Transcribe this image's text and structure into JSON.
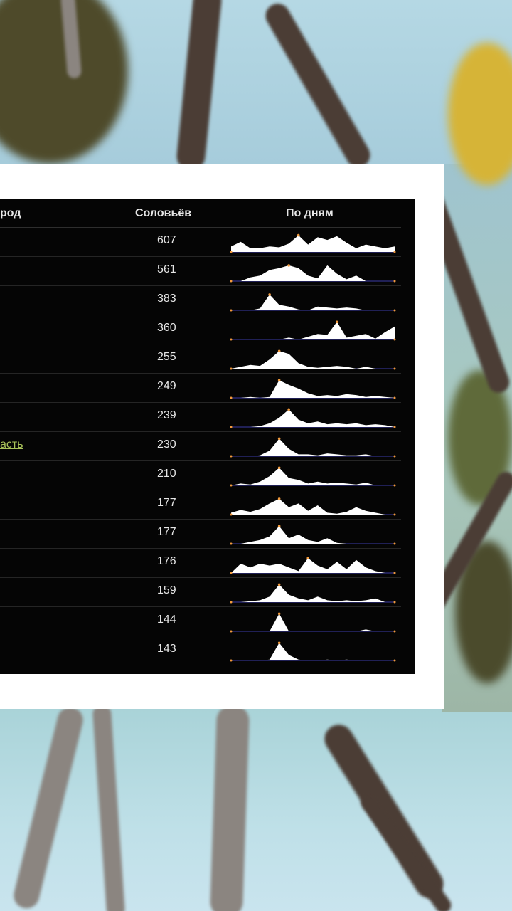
{
  "table": {
    "headers": {
      "city": "род",
      "count": "Соловьёв",
      "days": "По дням"
    },
    "rows": [
      {
        "city": "",
        "count": "607",
        "spark": [
          0.3,
          0.55,
          0.2,
          0.2,
          0.3,
          0.25,
          0.45,
          0.9,
          0.4,
          0.8,
          0.65,
          0.85,
          0.5,
          0.2,
          0.4,
          0.3,
          0.2,
          0.3
        ]
      },
      {
        "city": "",
        "count": "561",
        "spark": [
          0,
          0,
          0.2,
          0.3,
          0.6,
          0.7,
          0.85,
          0.7,
          0.3,
          0.15,
          0.85,
          0.4,
          0.1,
          0.3,
          0,
          0,
          0,
          0
        ]
      },
      {
        "city": "",
        "count": "383",
        "spark": [
          0,
          0,
          0,
          0.1,
          0.85,
          0.3,
          0.2,
          0.05,
          0,
          0.2,
          0.15,
          0.1,
          0.15,
          0.1,
          0,
          0,
          0,
          0
        ]
      },
      {
        "city": "",
        "count": "360",
        "spark": [
          0,
          0,
          0,
          0,
          0,
          0,
          0.1,
          0,
          0.15,
          0.3,
          0.25,
          0.95,
          0.1,
          0.2,
          0.3,
          0.05,
          0.4,
          0.7
        ]
      },
      {
        "city": "",
        "count": "255",
        "spark": [
          0,
          0.1,
          0.2,
          0.15,
          0.5,
          0.95,
          0.8,
          0.3,
          0.1,
          0.05,
          0.1,
          0.15,
          0.1,
          0,
          0.1,
          0,
          0,
          0
        ]
      },
      {
        "city": "",
        "count": "249",
        "spark": [
          0,
          0,
          0.05,
          0,
          0.05,
          0.95,
          0.7,
          0.5,
          0.25,
          0.1,
          0.15,
          0.1,
          0.2,
          0.15,
          0.05,
          0.1,
          0.05,
          0
        ]
      },
      {
        "city": "",
        "count": "239",
        "spark": [
          0,
          0,
          0,
          0.05,
          0.2,
          0.5,
          0.95,
          0.4,
          0.2,
          0.3,
          0.15,
          0.2,
          0.15,
          0.2,
          0.1,
          0.15,
          0.1,
          0
        ]
      },
      {
        "city": "асть",
        "count": "230",
        "spark": [
          0,
          0,
          0,
          0.05,
          0.3,
          0.95,
          0.4,
          0.1,
          0.1,
          0.05,
          0.15,
          0.1,
          0.05,
          0.05,
          0.1,
          0,
          0,
          0
        ]
      },
      {
        "city": "",
        "count": "210",
        "spark": [
          0,
          0.1,
          0.05,
          0.2,
          0.5,
          0.95,
          0.4,
          0.3,
          0.1,
          0.2,
          0.1,
          0.15,
          0.1,
          0.05,
          0.15,
          0,
          0,
          0
        ]
      },
      {
        "city": "",
        "count": "177",
        "spark": [
          0.1,
          0.25,
          0.15,
          0.3,
          0.6,
          0.85,
          0.4,
          0.6,
          0.2,
          0.5,
          0.1,
          0.05,
          0.15,
          0.4,
          0.2,
          0.1,
          0,
          0
        ]
      },
      {
        "city": "",
        "count": "177",
        "spark": [
          0,
          0,
          0.1,
          0.2,
          0.4,
          0.95,
          0.3,
          0.5,
          0.2,
          0.1,
          0.3,
          0.05,
          0,
          0,
          0,
          0,
          0,
          0
        ]
      },
      {
        "city": "",
        "count": "176",
        "spark": [
          0,
          0.5,
          0.3,
          0.5,
          0.4,
          0.5,
          0.3,
          0.1,
          0.8,
          0.4,
          0.2,
          0.6,
          0.2,
          0.7,
          0.3,
          0.1,
          0,
          0
        ]
      },
      {
        "city": "",
        "count": "159",
        "spark": [
          0,
          0,
          0.05,
          0.1,
          0.3,
          0.95,
          0.4,
          0.2,
          0.1,
          0.3,
          0.1,
          0.05,
          0.1,
          0.05,
          0.1,
          0.2,
          0,
          0
        ]
      },
      {
        "city": "",
        "count": "144",
        "spark": [
          0,
          0,
          0,
          0,
          0,
          0.95,
          0,
          0,
          0,
          0,
          0,
          0,
          0,
          0,
          0.1,
          0,
          0,
          0
        ]
      },
      {
        "city": "",
        "count": "143",
        "spark": [
          0,
          0,
          0,
          0,
          0.05,
          0.95,
          0.3,
          0.05,
          0,
          0,
          0.05,
          0,
          0.05,
          0,
          0,
          0,
          0,
          0
        ]
      }
    ]
  },
  "colors": {
    "spark_fill": "#ffffff",
    "spark_peak": "#f29a3c",
    "spark_base": "#3a3aa8",
    "link": "#a9c25a"
  }
}
